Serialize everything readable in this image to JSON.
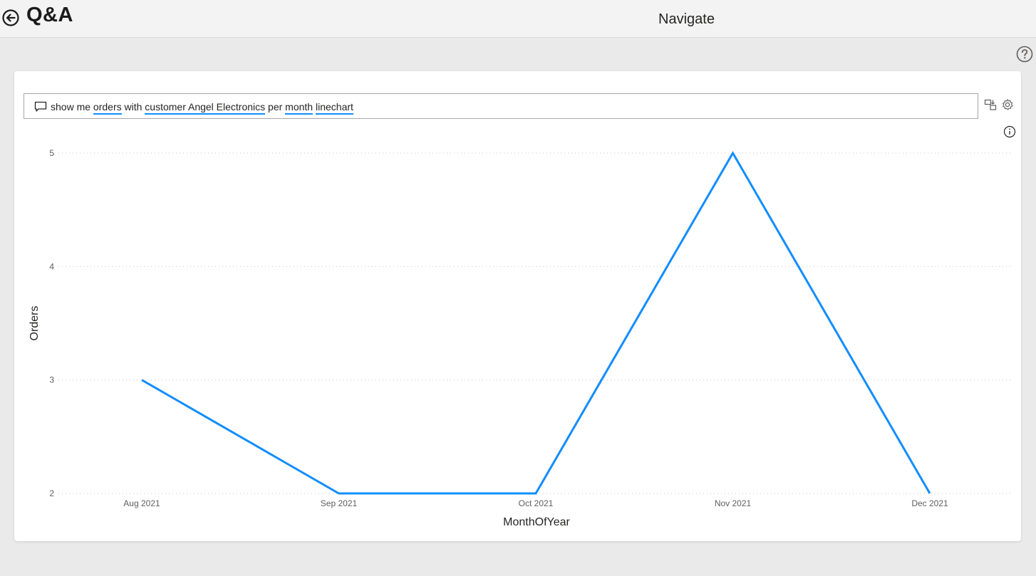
{
  "header": {
    "app_title": "Q&A",
    "nav_title": "Navigate"
  },
  "icons": {
    "back": "back-arrow-icon",
    "help": "help-icon",
    "question": "speech-bubble-icon",
    "convert": "convert-visual-icon",
    "settings": "gear-icon",
    "info": "info-icon"
  },
  "query": {
    "parts": [
      "show me ",
      "orders",
      " with ",
      "customer Angel Electronics",
      " per ",
      "month",
      " ",
      "linechart"
    ]
  },
  "colors": {
    "line": "#118dff",
    "token_underline": "#118dff"
  },
  "chart_data": {
    "type": "line",
    "categories": [
      "Aug 2021",
      "Sep 2021",
      "Oct 2021",
      "Nov 2021",
      "Dec 2021"
    ],
    "values": [
      3,
      2,
      2,
      5,
      2
    ],
    "xlabel": "MonthOfYear",
    "ylabel": "Orders",
    "ylim": [
      2,
      5
    ],
    "yticks": [
      "5",
      "4",
      "3",
      "2"
    ],
    "grid": "horizontal dotted"
  }
}
